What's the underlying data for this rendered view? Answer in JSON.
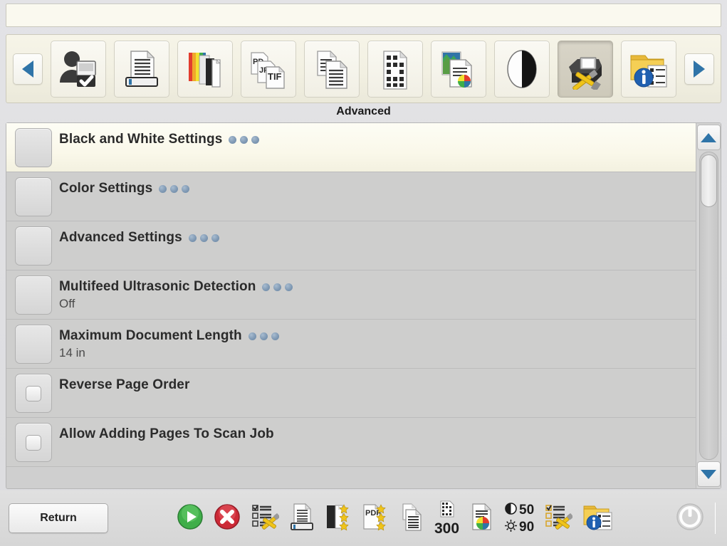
{
  "status_bar": {
    "message": ""
  },
  "toolbar": {
    "prev_label": "Previous",
    "next_label": "Next",
    "items": [
      {
        "id": "authentication",
        "icon": "user-scanner-check-icon",
        "selected": false
      },
      {
        "id": "destination",
        "icon": "document-scan-icon",
        "selected": false
      },
      {
        "id": "color-mode",
        "icon": "color-bw-pages-icon",
        "selected": false
      },
      {
        "id": "file-type",
        "icon": "pdf-jpg-tif-files-icon",
        "selected": false
      },
      {
        "id": "sides",
        "icon": "two-sided-pages-icon",
        "selected": false
      },
      {
        "id": "resolution",
        "icon": "halftone-grid-page-icon",
        "selected": false
      },
      {
        "id": "image-quality",
        "icon": "color-photo-page-icon",
        "selected": false
      },
      {
        "id": "contrast",
        "icon": "black-white-circle-icon",
        "selected": false
      },
      {
        "id": "advanced",
        "icon": "scanner-tools-icon",
        "selected": true
      },
      {
        "id": "job-info",
        "icon": "folder-info-icon",
        "selected": false
      }
    ]
  },
  "section": {
    "title": "Advanced"
  },
  "settings_list": {
    "rows": [
      {
        "label": "Black and White Settings",
        "value": "",
        "has_dots": true,
        "control": "button",
        "selected": true
      },
      {
        "label": "Color Settings",
        "value": "",
        "has_dots": true,
        "control": "button",
        "selected": false
      },
      {
        "label": "Advanced Settings",
        "value": "",
        "has_dots": true,
        "control": "button",
        "selected": false
      },
      {
        "label": "Multifeed Ultrasonic Detection",
        "value": "Off",
        "has_dots": true,
        "control": "button",
        "selected": false
      },
      {
        "label": "Maximum Document Length",
        "value": "14 in",
        "has_dots": true,
        "control": "button",
        "selected": false
      },
      {
        "label": "Reverse Page Order",
        "value": "",
        "has_dots": false,
        "control": "checkbox",
        "selected": false
      },
      {
        "label": "Allow Adding Pages To Scan Job",
        "value": "",
        "has_dots": false,
        "control": "checkbox",
        "selected": false
      }
    ]
  },
  "scrollbar": {
    "up_label": "Scroll up",
    "down_label": "Scroll down"
  },
  "bottom_bar": {
    "return_label": "Return",
    "contrast_value": "50",
    "brightness_value": "90",
    "resolution_value": "300",
    "icons": [
      {
        "id": "start-scan",
        "icon": "green-play-icon"
      },
      {
        "id": "cancel-job",
        "icon": "red-x-cancel-icon"
      },
      {
        "id": "job-settings",
        "icon": "checklist-tools-icon"
      },
      {
        "id": "destination-info",
        "icon": "document-scan-icon"
      },
      {
        "id": "color-mode-info",
        "icon": "bw-page-stars-icon"
      },
      {
        "id": "file-type-info",
        "icon": "pdf-stars-icon"
      },
      {
        "id": "sides-info",
        "icon": "two-sided-pages-icon"
      },
      {
        "id": "resolution-info",
        "icon": "halftone-300-icon"
      },
      {
        "id": "quality-info",
        "icon": "color-pie-page-icon"
      },
      {
        "id": "contrast-info",
        "icon": "contrast-brightness-icon"
      },
      {
        "id": "advanced-info",
        "icon": "checklist-tools-icon"
      },
      {
        "id": "job-info",
        "icon": "folder-info-icon"
      },
      {
        "id": "power",
        "icon": "power-icon"
      }
    ]
  },
  "colors": {
    "accent_blue": "#2f74a8",
    "dot_blue": "#7d97b2",
    "panel_gray": "#cececd",
    "selected_cream": "#faf8ea",
    "status_cream": "#faf9ef"
  }
}
